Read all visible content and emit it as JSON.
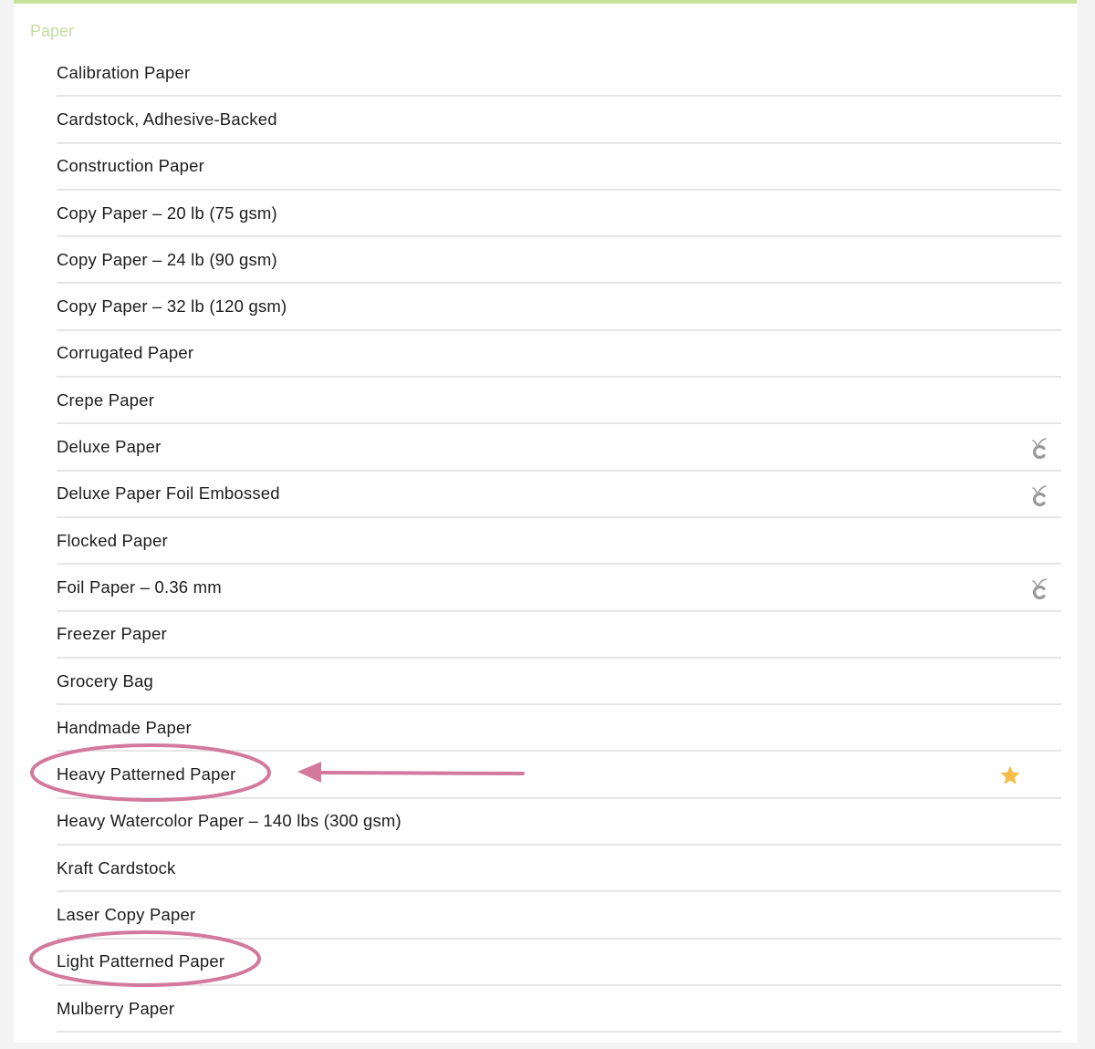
{
  "section": {
    "title": "Paper"
  },
  "colors": {
    "accent_green": "#c9e29a",
    "annotation_pink": "#d3799b",
    "star_gold": "#f3bd46",
    "icon_gray": "#9a9a9a"
  },
  "materials": [
    {
      "label": "Calibration Paper",
      "icon": null
    },
    {
      "label": "Cardstock, Adhesive-Backed",
      "icon": null
    },
    {
      "label": "Construction Paper",
      "icon": null
    },
    {
      "label": "Copy Paper – 20 lb (75 gsm)",
      "icon": null
    },
    {
      "label": "Copy Paper – 24 lb (90 gsm)",
      "icon": null
    },
    {
      "label": "Copy Paper – 32 lb (120 gsm)",
      "icon": null
    },
    {
      "label": "Corrugated Paper",
      "icon": null
    },
    {
      "label": "Crepe Paper",
      "icon": null
    },
    {
      "label": "Deluxe Paper",
      "icon": "cricut-icon"
    },
    {
      "label": "Deluxe Paper Foil Embossed",
      "icon": "cricut-icon"
    },
    {
      "label": "Flocked Paper",
      "icon": null
    },
    {
      "label": "Foil Paper – 0.36 mm",
      "icon": "cricut-icon"
    },
    {
      "label": "Freezer Paper",
      "icon": null
    },
    {
      "label": "Grocery Bag",
      "icon": null
    },
    {
      "label": "Handmade Paper",
      "icon": null
    },
    {
      "label": "Heavy Patterned Paper",
      "icon": "star-icon",
      "annotated": true
    },
    {
      "label": "Heavy Watercolor Paper – 140 lbs (300 gsm)",
      "icon": null
    },
    {
      "label": "Kraft Cardstock",
      "icon": null
    },
    {
      "label": "Laser Copy Paper",
      "icon": null
    },
    {
      "label": "Light Patterned Paper",
      "icon": null,
      "annotated": true
    },
    {
      "label": "Mulberry Paper",
      "icon": null
    }
  ]
}
